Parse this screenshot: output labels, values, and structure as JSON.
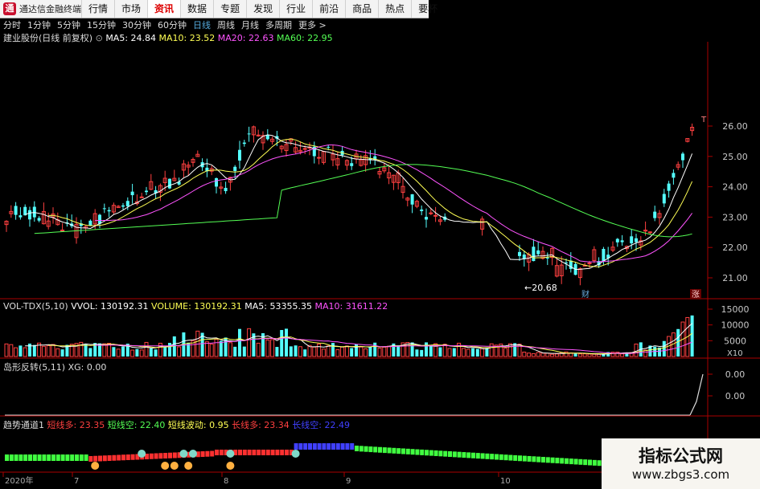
{
  "app": {
    "title": "通达信金融终端"
  },
  "nav": [
    "行情",
    "市场",
    "资讯",
    "数据",
    "专题",
    "发现",
    "行业",
    "前沿",
    "商品",
    "热点",
    "要杯"
  ],
  "nav_active": 2,
  "periods": [
    "分时",
    "1分钟",
    "5分钟",
    "15分钟",
    "30分钟",
    "60分钟",
    "日线",
    "周线",
    "月线",
    "多周期",
    "更多 >"
  ],
  "period_active": 6,
  "main": {
    "stock": "建业股份(日线 前复权)",
    "ma5": "MA5: 24.84",
    "ma10": "MA10: 23.52",
    "ma20": "MA20: 22.63",
    "ma60": "MA60: 22.95",
    "low_label": "←20.68",
    "mark_cai": "财",
    "mark_zhang": "涨",
    "mark_top": "T"
  },
  "price_axis": [
    "26.00",
    "25.00",
    "24.00",
    "23.00",
    "22.00",
    "21.00"
  ],
  "volume": {
    "name": "VOL-TDX(5,10)",
    "vvol": "VVOL: 130192.31",
    "volume": "VOLUME: 130192.31",
    "ma5": "MA5: 53355.35",
    "ma10": "MA10: 31611.22",
    "axis": [
      "15000",
      "10000",
      "5000"
    ],
    "unit": "X10"
  },
  "island": {
    "name": "岛形反转(5,11)",
    "xg": "XG: 0.00",
    "axis": [
      "0.00",
      "0.00"
    ]
  },
  "trend": {
    "name": "趋势通道1",
    "short_long": "短线多: 23.35",
    "short_short": "短线空: 22.40",
    "short_wave": "短线波动: 0.95",
    "long_long": "长线多: 23.34",
    "long_short": "长线空: 22.49"
  },
  "dates": [
    "2020年",
    "7",
    "8",
    "9",
    "10"
  ],
  "watermark": {
    "title": "指标公式网",
    "url": "www.zbgs3.com"
  },
  "colors": {
    "up": "#ff4040",
    "down": "#54ffff",
    "ma5": "#ffffff",
    "ma10": "#ffff54",
    "ma20": "#ff54ff",
    "ma60": "#54ff54",
    "axis": "#aa0000"
  }
}
